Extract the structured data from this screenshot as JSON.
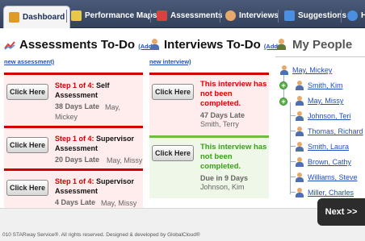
{
  "nav": {
    "tabs": [
      {
        "label": "Dashboard",
        "icon": "home-icon",
        "color": "#e09a2a"
      },
      {
        "label": "Performance Maps",
        "icon": "map-icon",
        "color": "#e8c84a"
      },
      {
        "label": "Assessments",
        "icon": "chart-icon",
        "color": "#d94040"
      },
      {
        "label": "Interviews",
        "icon": "person-icon",
        "color": "#e7a96a"
      },
      {
        "label": "Suggestions",
        "icon": "suggestion-icon",
        "color": "#4a8fe0"
      },
      {
        "label": "H",
        "icon": "help-icon",
        "color": "#4a8fe0"
      }
    ]
  },
  "assessments": {
    "title": "Assessments To-Do",
    "add_link": "(Add a",
    "add_link2": "new assessment)",
    "cards": [
      {
        "button": "Click Here",
        "step": "Step 1 of 4:",
        "type": "Self",
        "type2": "Assessment",
        "late": "38 Days Late",
        "who1": "May,",
        "who2": "Mickey"
      },
      {
        "button": "Click Here",
        "step": "Step 1 of 4:",
        "type": "Supervisor",
        "type2": "Assessment",
        "late": "20 Days Late",
        "who1": "May, Missy",
        "who2": ""
      },
      {
        "button": "Click Here",
        "step": "Step 1 of 4:",
        "type": "Supervisor",
        "type2": "Assessment",
        "late": "4 Days Late",
        "who1": "May, Missy",
        "who2": ""
      }
    ]
  },
  "interviews": {
    "title": "Interviews To-Do",
    "add_link": "(Add a",
    "add_link2": "new interview)",
    "cards": [
      {
        "button": "Click Here",
        "msg1": "This interview has",
        "msg2": "not been",
        "msg3": "completed.",
        "meta1": "47 Days Late",
        "meta2": "Smith, Terry"
      },
      {
        "button": "Click Here",
        "msg1": "This interview has",
        "msg2": "not been",
        "msg3": "completed.",
        "meta1": "Due in 9 Days",
        "meta2": "Johnson, Kim"
      }
    ]
  },
  "people": {
    "title": "My People",
    "root": "May, Mickey",
    "children": [
      "Smith, Kim",
      "May, Missy",
      "Johnson, Teri",
      "Thomas, Richard",
      "Smith, Laura",
      "Brown, Cathy",
      "Williams, Steve",
      "Miller, Charles"
    ]
  },
  "footer": {
    "copyright": "010 STARway Service®. All rights reserved. Designed & developed by GlobalCloud®",
    "next": "Next >>"
  }
}
